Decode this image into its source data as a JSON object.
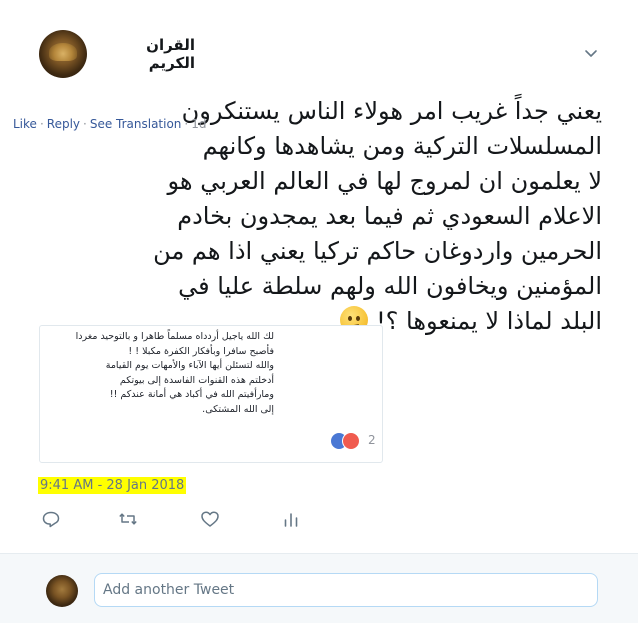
{
  "author": {
    "display_name": "القران الكريم"
  },
  "icons": {
    "caret": "chevron-down-icon",
    "reply": "reply-icon",
    "retweet": "retweet-icon",
    "like": "heart-icon",
    "analytics": "analytics-icon"
  },
  "tweet": {
    "lines": [
      "يعني جداً غريب امر هولاء الناس يستنكرون",
      "المسلسلات التركية ومن يشاهدها وكانهم",
      "لا يعلمون ان لمروج لها في العالم العربي هو",
      "الاعلام السعودي ثم فيما بعد يمجدون بخادم",
      "الحرمين واردوغان حاكم تركيا يعني اذا هم من",
      "المؤمنين ويخافون الله ولهم سلطة عليا في",
      "البلد لماذا لا يمنعوها ؟!"
    ],
    "emoji": "confused-face"
  },
  "embedded_comment": {
    "lines": [
      "لك الله ياجيل أردداه مسلماً طاهرا و بالتوحيد مغردا",
      "فأصبح سافرا وبأفكار الكفرة مكبلا ! !",
      "والله لتسئلن أيها الآباء والأمهات يوم القيامة",
      "أدخلتم هذه القنوات الفاسدة إلى بيوتكم",
      "ومارأفيتم الله في أكباد هي أمانة عندكم !!",
      "إلى الله المشتكى."
    ],
    "actions": {
      "like": "Like",
      "reply": "Reply",
      "translate": "See Translation",
      "time": "1d",
      "sep": "·"
    },
    "reaction_count": "2"
  },
  "timestamp": "9:41 AM - 28 Jan 2018",
  "reply_box": {
    "placeholder": "Add another Tweet"
  },
  "colors": {
    "highlight": "#ffff00",
    "link_blue": "#365899",
    "muted": "#657786"
  }
}
